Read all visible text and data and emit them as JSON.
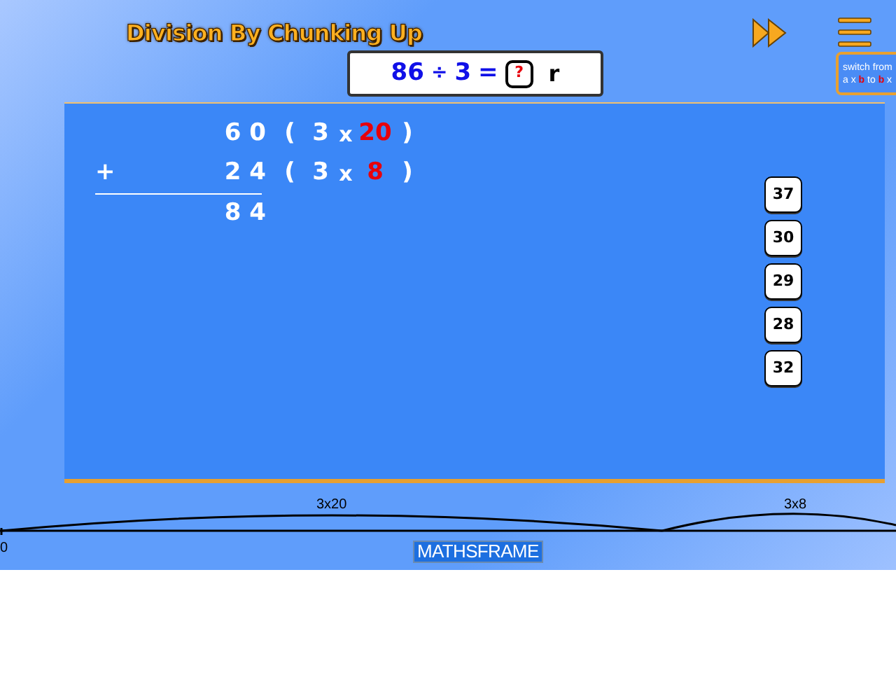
{
  "title": "Division By Chunking Up",
  "question": {
    "dividend": "86",
    "operator": "÷",
    "divisor": "3",
    "equals": "=",
    "unknown": "?",
    "remainder_label": "r"
  },
  "switch_button": {
    "line_1": "switch from",
    "line_2": [
      {
        "text": "a x ",
        "highlight": false
      },
      {
        "text": "b",
        "highlight": true
      },
      {
        "text": " to ",
        "highlight": false
      },
      {
        "text": "b",
        "highlight": true
      },
      {
        "text": " x",
        "highlight": false
      }
    ]
  },
  "working": {
    "rows": [
      {
        "sign": "",
        "value": "60",
        "open": "(",
        "factor": "3",
        "times": "x",
        "multiplier": "20",
        "close": ")"
      },
      {
        "sign": "+",
        "value": "24",
        "open": "(",
        "factor": "3",
        "times": "x",
        "multiplier": "8",
        "close": ")"
      }
    ],
    "total": "84"
  },
  "answer_options": [
    "37",
    "30",
    "29",
    "28",
    "32"
  ],
  "number_line": {
    "start": "0",
    "jumps": [
      {
        "label": "3x20"
      },
      {
        "label": "3x8"
      }
    ]
  },
  "logo": "MATHSFRAME"
}
